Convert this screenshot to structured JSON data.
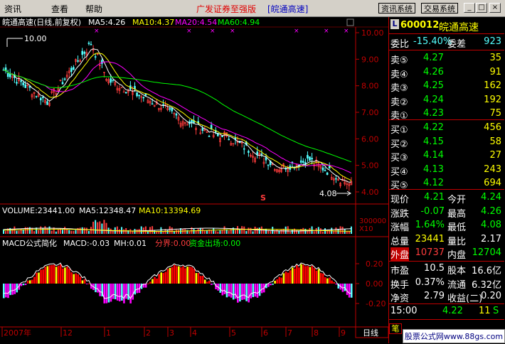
{
  "menu": {
    "items": [
      "资讯",
      "查看",
      "帮助"
    ],
    "title_red": "广发证券至强版",
    "title_blue": "[皖通高速]",
    "btn_info": "资讯系统",
    "btn_trade": "交易系统",
    "win_min": "_",
    "win_max": "□",
    "win_close": "×"
  },
  "chart": {
    "header_name": "皖通高速(日线,前复权)",
    "ma5": "MA5:4.26",
    "ma10": "MA10:4.37",
    "ma20": "MA20:4.54",
    "ma60": "MA60:4.94",
    "high_label": "10.00",
    "low_label": "4.08",
    "s_marker": "S",
    "price_ticks": [
      "10.00",
      "9.00",
      "8.00",
      "7.00",
      "6.00",
      "5.00",
      "4.00"
    ],
    "volume_header": "VOLUME:23441.00",
    "vol_ma5": "MA5:12348.47",
    "vol_ma10": "MA10:13394.69",
    "vol_ticks": [
      "300000",
      "X10"
    ],
    "macd_header": "MACD公式简化",
    "macd_val": "MACD:-0.03",
    "mh_val": "MH:0.01",
    "fenjie": "分界:0.00",
    "zijin": "资金出场:0.00",
    "macd_ticks": [
      "0.20",
      "0.00",
      "-0.20"
    ],
    "date_labels": [
      "2007年",
      "12",
      "1",
      "2",
      "3",
      "4",
      "5",
      "6",
      "7",
      "8",
      "9"
    ],
    "period_tab": "日线",
    "bottom_tab": "笔"
  },
  "colors": {
    "up": "#ff3c3c",
    "down": "#54ffff",
    "ma5": "#ffffff",
    "ma10": "#ffff00",
    "ma20": "#ff00ff",
    "ma60": "#00ff00",
    "frame": "#c00000"
  },
  "quote": {
    "code": "600012",
    "name": "皖通高速",
    "weibi_label": "委比",
    "weibi_value": "-15.40%",
    "weicha_label": "委差",
    "weicha_value": "923",
    "asks": [
      {
        "label": "卖⑤",
        "price": "4.27",
        "vol": "35"
      },
      {
        "label": "卖④",
        "price": "4.26",
        "vol": "91"
      },
      {
        "label": "卖③",
        "price": "4.25",
        "vol": "162"
      },
      {
        "label": "卖②",
        "price": "4.24",
        "vol": "192"
      },
      {
        "label": "卖①",
        "price": "4.23",
        "vol": "75"
      }
    ],
    "bids": [
      {
        "label": "买①",
        "price": "4.22",
        "vol": "456"
      },
      {
        "label": "买②",
        "price": "4.15",
        "vol": "58"
      },
      {
        "label": "买③",
        "price": "4.14",
        "vol": "27"
      },
      {
        "label": "买④",
        "price": "4.13",
        "vol": "243"
      },
      {
        "label": "买⑤",
        "price": "4.12",
        "vol": "694"
      }
    ],
    "stats": [
      {
        "l1": "现价",
        "v1": "4.21",
        "l2": "今开",
        "v2": "4.24"
      },
      {
        "l1": "涨跌",
        "v1": "-0.07",
        "l2": "最高",
        "v2": "4.26"
      },
      {
        "l1": "涨幅",
        "v1": "1.64%",
        "l2": "最低",
        "v2": "4.08"
      },
      {
        "l1": "总量",
        "v1": "23441",
        "l2": "量比",
        "v2": "2.17"
      },
      {
        "l1": "外盘",
        "v1": "10737",
        "l2": "内盘",
        "v2": "12704"
      }
    ],
    "fund": [
      {
        "l1": "市盈",
        "v1": "10.5",
        "l2": "股本",
        "v2": "16.6亿"
      },
      {
        "l1": "换手",
        "v1": "0.37%",
        "l2": "流通",
        "v2": "6.32亿"
      },
      {
        "l1": "净资",
        "v1": "2.79",
        "l2": "收益(二)",
        "v2": "0.20"
      }
    ],
    "tick": {
      "time": "15:00",
      "price": "4.22",
      "vol": "11",
      "side": "S"
    }
  },
  "footer": {
    "ad": "股票公式网www.88gs.com"
  }
}
